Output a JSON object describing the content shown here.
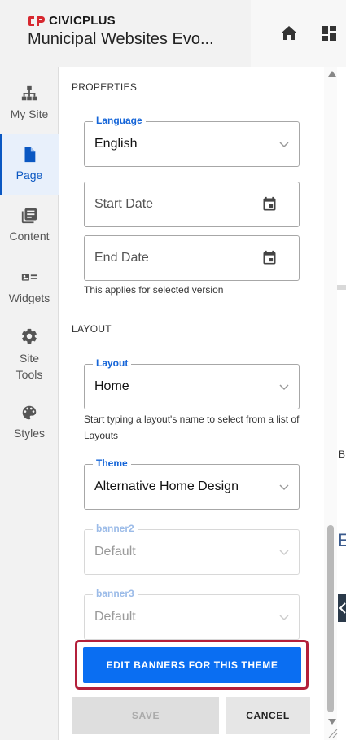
{
  "header": {
    "brand": "CIVICPLUS",
    "site_title": "Municipal Websites Evo...",
    "brand_color": "#d7282f"
  },
  "nav": [
    {
      "label": "My Site",
      "icon": "sitemap-icon"
    },
    {
      "label": "Page",
      "icon": "page-icon",
      "active": true
    },
    {
      "label": "Content",
      "icon": "content-library-icon"
    },
    {
      "label": "Widgets",
      "icon": "widgets-icon"
    },
    {
      "label": "Site Tools",
      "icon": "gear-icon"
    },
    {
      "label": "Styles",
      "icon": "palette-icon"
    }
  ],
  "properties": {
    "section_label": "PROPERTIES",
    "language": {
      "label": "Language",
      "value": "English"
    },
    "start_date": {
      "placeholder": "Start Date"
    },
    "end_date": {
      "placeholder": "End Date"
    },
    "help": "This applies for selected version"
  },
  "layout": {
    "section_label": "LAYOUT",
    "layout": {
      "label": "Layout",
      "value": "Home"
    },
    "help": "Start typing a layout's name to select from a list of Layouts",
    "theme": {
      "label": "Theme",
      "value": "Alternative Home Design"
    },
    "banner2": {
      "label": "banner2",
      "value": "Default"
    },
    "banner3": {
      "label": "banner3",
      "value": "Default"
    }
  },
  "actions": {
    "edit_banners": "EDIT BANNERS FOR THIS THEME",
    "save": "SAVE",
    "cancel": "CANCEL",
    "primary_color": "#0a6ef2",
    "highlight_color": "#b3203b"
  },
  "background": {
    "letter_small": "B",
    "letter_large": "E"
  }
}
